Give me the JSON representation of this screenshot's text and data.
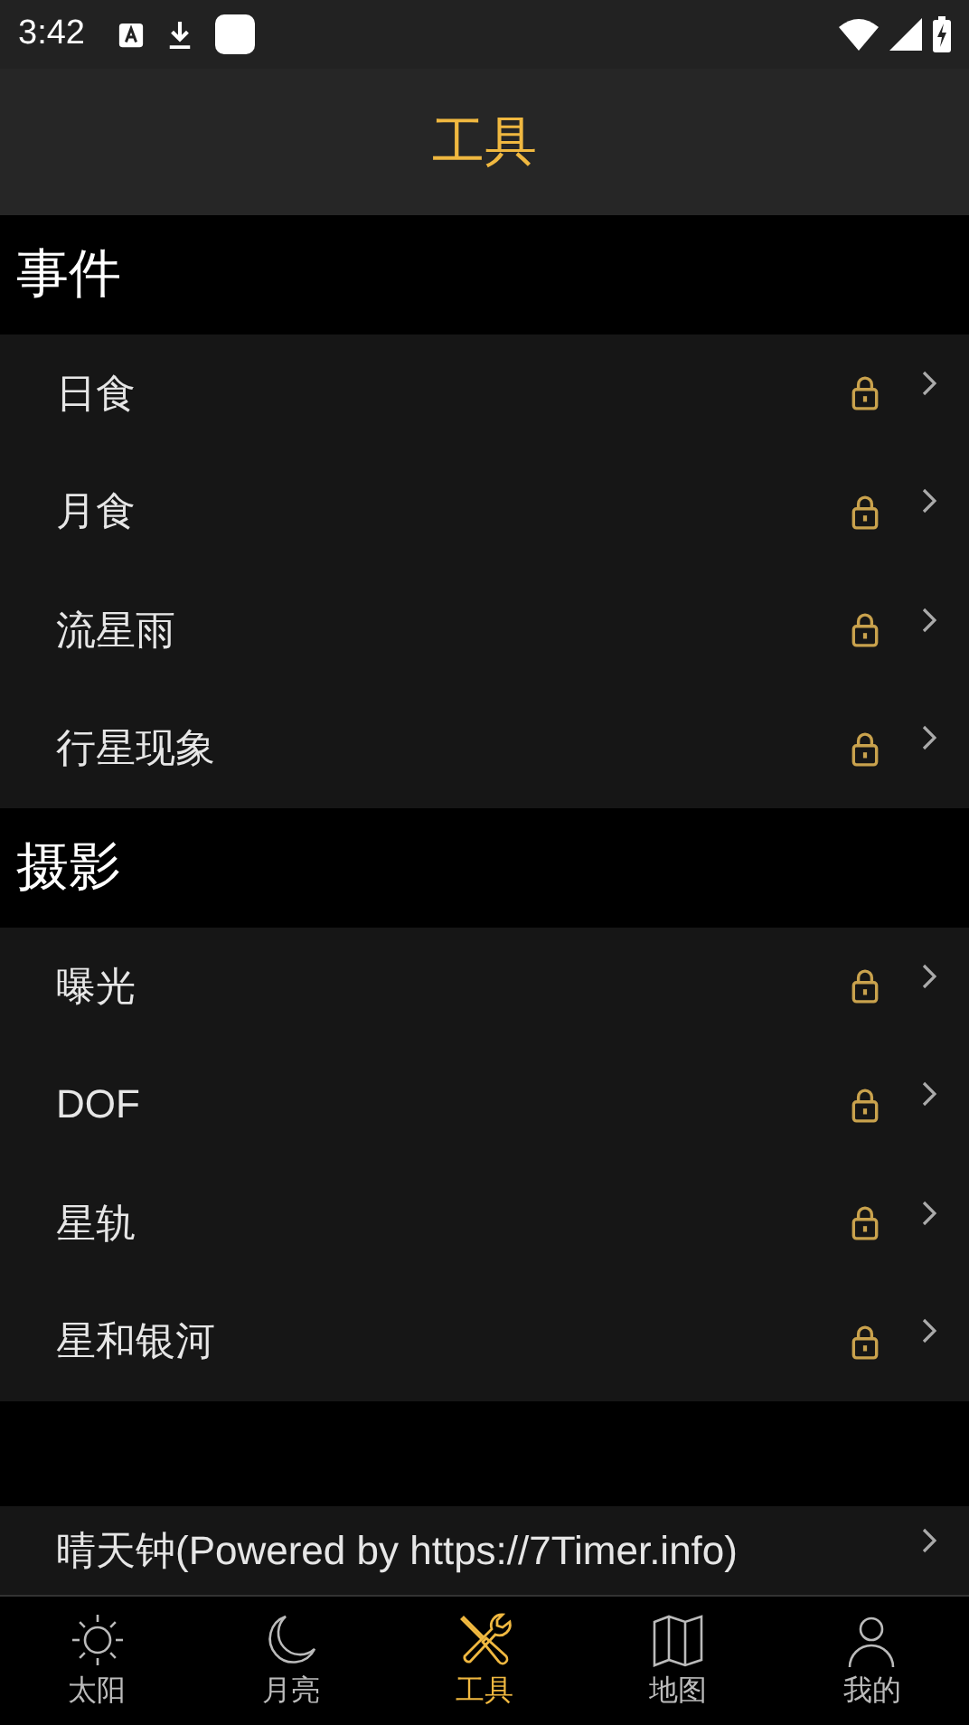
{
  "status_bar": {
    "time": "3:42"
  },
  "header": {
    "title": "工具"
  },
  "sections": [
    {
      "title": "事件",
      "items": [
        {
          "label": "日食",
          "locked": true
        },
        {
          "label": "月食",
          "locked": true
        },
        {
          "label": "流星雨",
          "locked": true
        },
        {
          "label": "行星现象",
          "locked": true
        }
      ]
    },
    {
      "title": "摄影",
      "items": [
        {
          "label": "曝光",
          "locked": true
        },
        {
          "label": "DOF",
          "locked": true
        },
        {
          "label": "星轨",
          "locked": true
        },
        {
          "label": "星和银河",
          "locked": true
        }
      ]
    }
  ],
  "extra_items": [
    {
      "label": "晴天钟(Powered by https://7Timer.info)",
      "locked": false
    }
  ],
  "bottom_nav": [
    {
      "label": "太阳",
      "kind": "sun",
      "selected": false
    },
    {
      "label": "月亮",
      "kind": "moon",
      "selected": false
    },
    {
      "label": "工具",
      "kind": "tools",
      "selected": true
    },
    {
      "label": "地图",
      "kind": "map",
      "selected": false
    },
    {
      "label": "我的",
      "kind": "person",
      "selected": false
    }
  ]
}
